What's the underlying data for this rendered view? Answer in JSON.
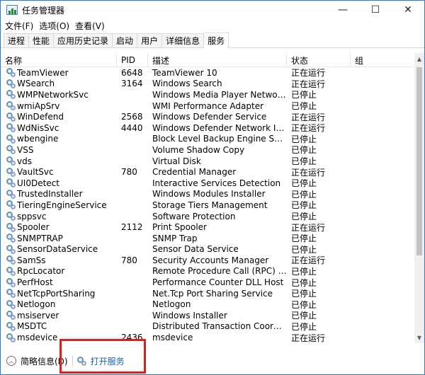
{
  "window": {
    "title": "任务管理器",
    "controls": {
      "minimize": "—",
      "maximize": "☐",
      "close": "✕"
    }
  },
  "menu": [
    "文件(F)",
    "选项(O)",
    "查看(V)"
  ],
  "tabs": [
    {
      "label": "进程",
      "active": false
    },
    {
      "label": "性能",
      "active": false
    },
    {
      "label": "应用历史记录",
      "active": false
    },
    {
      "label": "启动",
      "active": false
    },
    {
      "label": "用户",
      "active": false
    },
    {
      "label": "详细信息",
      "active": false
    },
    {
      "label": "服务",
      "active": true
    }
  ],
  "columns": {
    "name": "名称",
    "pid": "PID",
    "desc": "描述",
    "status": "状态",
    "group": "组"
  },
  "sort_arrow": "^",
  "services": [
    {
      "name": "TeamViewer",
      "pid": "6648",
      "desc": "TeamViewer 10",
      "status": "正在运行"
    },
    {
      "name": "WSearch",
      "pid": "3164",
      "desc": "Windows Search",
      "status": "正在运行"
    },
    {
      "name": "WMPNetworkSvc",
      "pid": "",
      "desc": "Windows Media Player Network Sh...",
      "status": "已停止"
    },
    {
      "name": "wmiApSrv",
      "pid": "",
      "desc": "WMI Performance Adapter",
      "status": "已停止"
    },
    {
      "name": "WinDefend",
      "pid": "2568",
      "desc": "Windows Defender Service",
      "status": "正在运行"
    },
    {
      "name": "WdNisSvc",
      "pid": "4440",
      "desc": "Windows Defender Network Inspec...",
      "status": "正在运行"
    },
    {
      "name": "wbengine",
      "pid": "",
      "desc": "Block Level Backup Engine Service",
      "status": "已停止"
    },
    {
      "name": "VSS",
      "pid": "",
      "desc": "Volume Shadow Copy",
      "status": "已停止"
    },
    {
      "name": "vds",
      "pid": "",
      "desc": "Virtual Disk",
      "status": "已停止"
    },
    {
      "name": "VaultSvc",
      "pid": "780",
      "desc": "Credential Manager",
      "status": "正在运行"
    },
    {
      "name": "UI0Detect",
      "pid": "",
      "desc": "Interactive Services Detection",
      "status": "已停止"
    },
    {
      "name": "TrustedInstaller",
      "pid": "",
      "desc": "Windows Modules Installer",
      "status": "已停止"
    },
    {
      "name": "TieringEngineService",
      "pid": "",
      "desc": "Storage Tiers Management",
      "status": "已停止"
    },
    {
      "name": "sppsvc",
      "pid": "",
      "desc": "Software Protection",
      "status": "已停止"
    },
    {
      "name": "Spooler",
      "pid": "2112",
      "desc": "Print Spooler",
      "status": "正在运行"
    },
    {
      "name": "SNMPTRAP",
      "pid": "",
      "desc": "SNMP Trap",
      "status": "已停止"
    },
    {
      "name": "SensorDataService",
      "pid": "",
      "desc": "Sensor Data Service",
      "status": "已停止"
    },
    {
      "name": "SamSs",
      "pid": "780",
      "desc": "Security Accounts Manager",
      "status": "正在运行"
    },
    {
      "name": "RpcLocator",
      "pid": "",
      "desc": "Remote Procedure Call (RPC) Locat...",
      "status": "已停止"
    },
    {
      "name": "PerfHost",
      "pid": "",
      "desc": "Performance Counter DLL Host",
      "status": "已停止"
    },
    {
      "name": "NetTcpPortSharing",
      "pid": "",
      "desc": "Net.Tcp Port Sharing Service",
      "status": "已停止"
    },
    {
      "name": "Netlogon",
      "pid": "",
      "desc": "Netlogon",
      "status": "已停止"
    },
    {
      "name": "msiserver",
      "pid": "",
      "desc": "Windows Installer",
      "status": "已停止"
    },
    {
      "name": "MSDTC",
      "pid": "",
      "desc": "Distributed Transaction Coordinator",
      "status": "已停止"
    },
    {
      "name": "msdevice",
      "pid": "2436",
      "desc": "msdevice",
      "status": "正在运行"
    }
  ],
  "footer": {
    "fewer_details": "简略信息(D)",
    "open_services": "打开服务"
  },
  "icons": {
    "service": "gears-icon",
    "chevron": "chevron-up-icon"
  },
  "colors": {
    "link": "#1a5fb4",
    "highlight": "#e02020",
    "window_border": "#2b79d8"
  }
}
